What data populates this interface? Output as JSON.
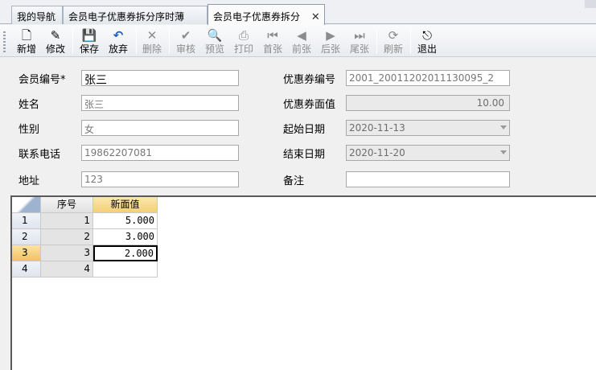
{
  "tabs": [
    {
      "label": "我的导航"
    },
    {
      "label": "会员电子优惠券拆分序时薄"
    },
    {
      "label": "会员电子优惠券拆分",
      "close": "✕"
    }
  ],
  "toolbar": [
    {
      "label": "新增",
      "icon": "new-doc-icon",
      "glyph": "🗋",
      "enabled": true
    },
    {
      "label": "修改",
      "icon": "edit-icon",
      "glyph": "✎",
      "enabled": true
    },
    {
      "label": "保存",
      "icon": "save-icon",
      "glyph": "💾",
      "enabled": true
    },
    {
      "label": "放弃",
      "icon": "undo-icon",
      "glyph": "↶",
      "enabled": true
    },
    {
      "label": "删除",
      "icon": "delete-icon",
      "glyph": "✕",
      "enabled": false
    },
    {
      "label": "审核",
      "icon": "audit-icon",
      "glyph": "✔",
      "enabled": false
    },
    {
      "label": "预览",
      "icon": "preview-icon",
      "glyph": "🔍",
      "enabled": false
    },
    {
      "label": "打印",
      "icon": "print-icon",
      "glyph": "⎙",
      "enabled": false
    },
    {
      "label": "首张",
      "icon": "first-record-icon",
      "glyph": "⏮",
      "enabled": false
    },
    {
      "label": "前张",
      "icon": "prev-record-icon",
      "glyph": "◀",
      "enabled": false
    },
    {
      "label": "后张",
      "icon": "next-record-icon",
      "glyph": "▶",
      "enabled": false
    },
    {
      "label": "尾张",
      "icon": "last-record-icon",
      "glyph": "⏭",
      "enabled": false
    },
    {
      "label": "刷新",
      "icon": "refresh-icon",
      "glyph": "⟳",
      "enabled": false
    },
    {
      "label": "退出",
      "icon": "exit-icon",
      "glyph": "⎋",
      "enabled": true
    }
  ],
  "form": {
    "member_no_label": "会员编号*",
    "member_no_value": "张三",
    "name_label": "姓名",
    "name_value": "张三",
    "gender_label": "性别",
    "gender_value": "女",
    "phone_label": "联系电话",
    "phone_value": "19862207081",
    "address_label": "地址",
    "address_value": "123",
    "coupon_no_label": "优惠券编号",
    "coupon_no_value": "2001_20011202011130095_2",
    "face_value_label": "优惠券面值",
    "face_value_value": "10.00",
    "start_date_label": "起始日期",
    "start_date_value": "2020-11-13",
    "end_date_label": "结束日期",
    "end_date_value": "2020-11-20",
    "remark_label": "备注",
    "remark_value": ""
  },
  "grid": {
    "headers": [
      "序号",
      "新面值"
    ],
    "rows": [
      {
        "row": "1",
        "index": "1",
        "value": "5.000"
      },
      {
        "row": "2",
        "index": "2",
        "value": "3.000"
      },
      {
        "row": "3",
        "index": "3",
        "value": "2.000"
      },
      {
        "row": "4",
        "index": "4",
        "value": ""
      }
    ],
    "selected_row": 3
  },
  "colors": {
    "selection": "#f3cf76",
    "save_icon": "#1f5fbf"
  }
}
